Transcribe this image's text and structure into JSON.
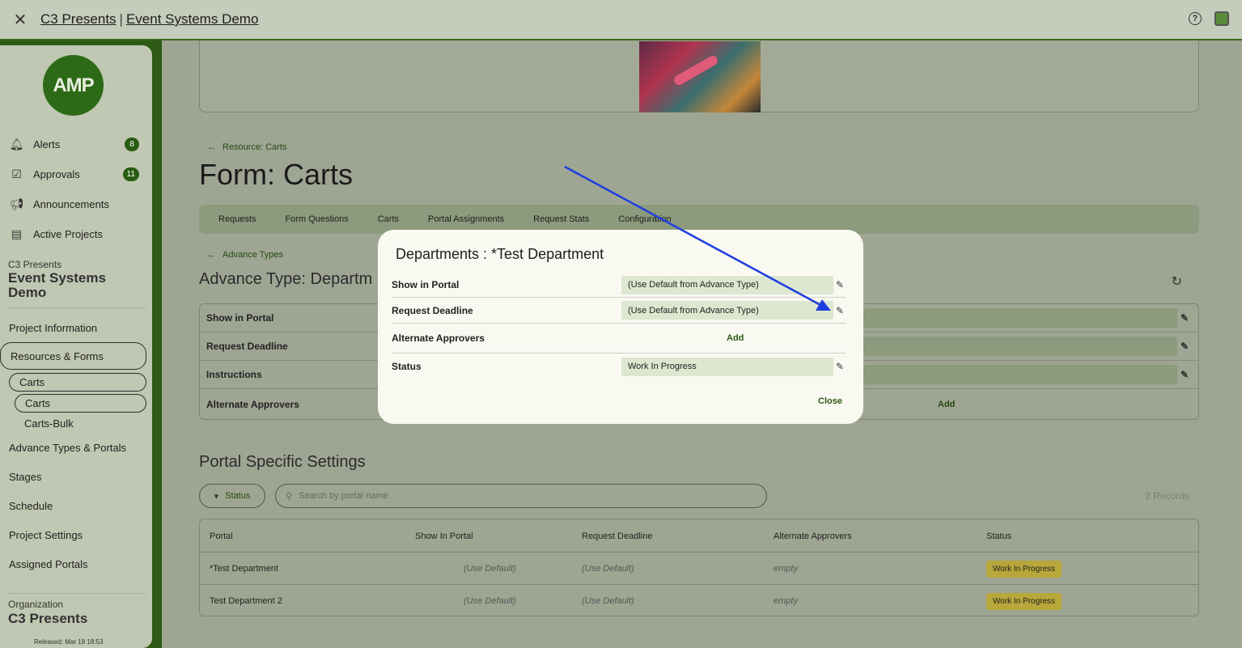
{
  "topbar": {
    "close_icon": "close-icon",
    "org": "C3 Presents",
    "separator": "|",
    "project": "Event Systems Demo",
    "help_icon": "?"
  },
  "sidebar": {
    "logo_text": "AMP",
    "nav": [
      {
        "label": "Alerts",
        "icon": "bell-icon",
        "badge": "8"
      },
      {
        "label": "Approvals",
        "icon": "checkbox-icon",
        "badge": "11"
      },
      {
        "label": "Announcements",
        "icon": "megaphone-icon",
        "badge": ""
      },
      {
        "label": "Active Projects",
        "icon": "projects-icon",
        "badge": ""
      }
    ],
    "project_label": "C3 Presents",
    "project_name": "Event Systems Demo",
    "menu": {
      "project_information": "Project Information",
      "resources_forms": "Resources & Forms",
      "carts_parent": "Carts",
      "carts_child": "Carts",
      "carts_bulk": "Carts-Bulk",
      "advance_types": "Advance Types & Portals",
      "stages": "Stages",
      "schedule": "Schedule",
      "project_settings": "Project Settings",
      "assigned_portals": "Assigned Portals"
    },
    "org_label": "Organization",
    "org_name": "C3 Presents",
    "released": "Released: Mar 18 18:53"
  },
  "main": {
    "back_resource": "Resource: Carts",
    "page_title": "Form: Carts",
    "tabs": [
      "Requests",
      "Form Questions",
      "Carts",
      "Portal Assignments",
      "Request Stats",
      "Configuration"
    ],
    "back_advance": "Advance Types",
    "section_title": "Advance Type: Departm",
    "settings": {
      "show_in_portal": "Show in Portal",
      "request_deadline": "Request Deadline",
      "instructions": "Instructions",
      "alternate_approvers": "Alternate Approvers",
      "add": "Add"
    },
    "portal_title": "Portal Specific Settings",
    "status_filter": "Status",
    "search_placeholder": "Search by portal name",
    "records": "2 Records",
    "table": {
      "headers": [
        "Portal",
        "Show In Portal",
        "Request Deadline",
        "Alternate Approvers",
        "Status"
      ],
      "rows": [
        {
          "portal": "*Test Department",
          "show": "(Use Default)",
          "deadline": "(Use Default)",
          "approvers": "empty",
          "status": "Work In Progress"
        },
        {
          "portal": "Test Department 2",
          "show": "(Use Default)",
          "deadline": "(Use Default)",
          "approvers": "empty",
          "status": "Work In Progress"
        }
      ]
    }
  },
  "modal": {
    "title": "Departments : *Test Department",
    "rows": {
      "show_label": "Show in Portal",
      "show_value": "(Use Default from Advance Type)",
      "deadline_label": "Request Deadline",
      "deadline_value": "(Use Default from Advance Type)",
      "approvers_label": "Alternate Approvers",
      "approvers_add": "Add",
      "status_label": "Status",
      "status_value": "Work In Progress"
    },
    "close": "Close"
  },
  "colors": {
    "accent": "#2d6a17",
    "annotation_arrow": "#1f3ee0",
    "wip_badge": "#b8a73a"
  }
}
